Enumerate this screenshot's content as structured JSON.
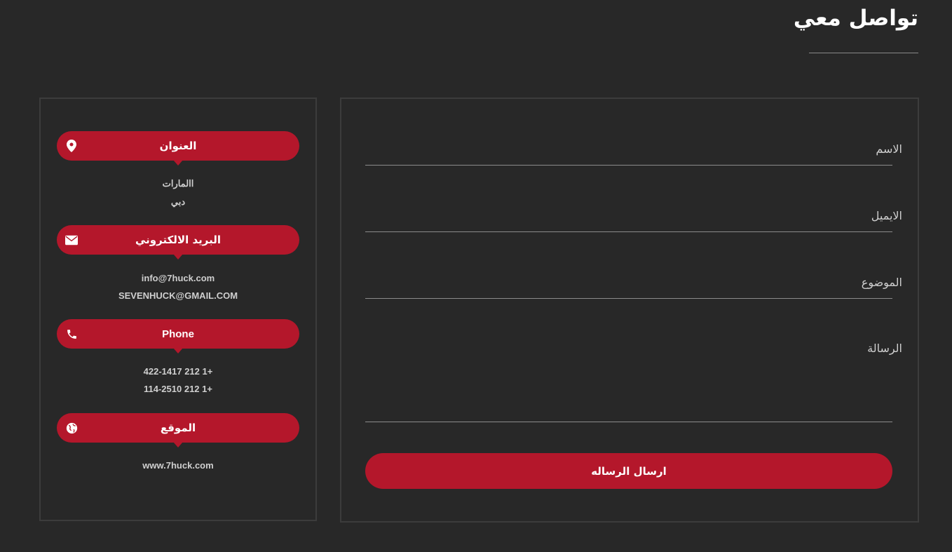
{
  "page": {
    "title": "تواصل معي"
  },
  "info": {
    "address": {
      "label": "العنوان",
      "icon": "map-marker-icon",
      "lines": [
        "االمارات",
        "دبي"
      ]
    },
    "email": {
      "label": "البريد الالكتروني",
      "icon": "envelope-icon",
      "lines": [
        "info@7huck.com",
        "SEVENHUCK@GMAIL.COM"
      ]
    },
    "phone": {
      "label": "Phone",
      "icon": "phone-icon",
      "lines": [
        "+1 212 422-1417",
        "+1 212 114-2510"
      ]
    },
    "website": {
      "label": "الموقع",
      "icon": "globe-icon",
      "lines": [
        "www.7huck.com"
      ]
    }
  },
  "form": {
    "name_label": "الاسم",
    "email_label": "الايميل",
    "subject_label": "الموضوع",
    "message_label": "الرسالة",
    "submit_label": "ارسال الرساله"
  },
  "colors": {
    "accent": "#b4172b",
    "background": "#282828",
    "border": "#3c3c3c"
  }
}
